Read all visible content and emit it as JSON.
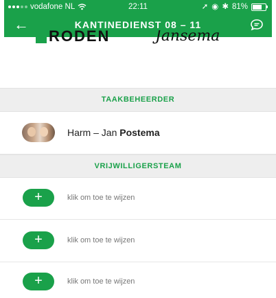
{
  "status": {
    "carrier": "vodafone NL",
    "time": "22:11",
    "battery": "81%",
    "battery_fill": 0.81
  },
  "header": {
    "title": "KANTINEDIENST 08 – 11"
  },
  "logos": {
    "left": "RODEN",
    "right": "Jansema"
  },
  "sections": {
    "manager": "TAAKBEHEERDER",
    "team": "VRIJWILLIGERSTEAM"
  },
  "manager": {
    "first": "Harm – Jan",
    "last": "Postema"
  },
  "slots": [
    {
      "hint": "klik om toe te wijzen"
    },
    {
      "hint": "klik om toe te wijzen"
    },
    {
      "hint": "klik om toe te wijzen"
    }
  ],
  "colors": {
    "accent": "#1aa14a",
    "section_bg": "#eeeeee"
  }
}
